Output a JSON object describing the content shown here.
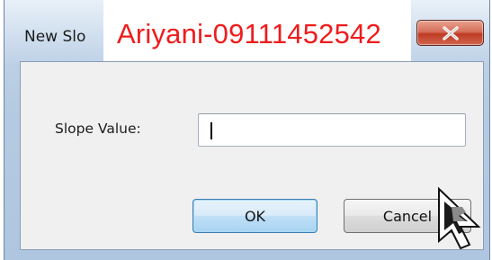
{
  "window": {
    "title": "New Slo",
    "close_glyph": "X",
    "close_icon": "close-icon"
  },
  "overlay": {
    "watermark_text": "Ariyani-09111452542"
  },
  "form": {
    "slope_label": "Slope Value:",
    "slope_value": ""
  },
  "buttons": {
    "ok_label": "OK",
    "cancel_label": "Cancel"
  },
  "colors": {
    "watermark": "#ee1c1c",
    "close_button": "#c94a33",
    "ok_focus_border": "#3c7fb1"
  }
}
